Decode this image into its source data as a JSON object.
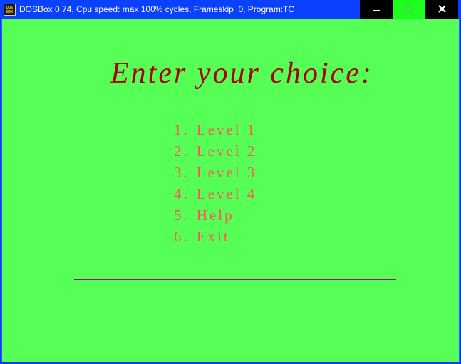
{
  "window": {
    "title": "DOSBox 0.74, Cpu speed: max 100% cycles, Frameskip  0, Program:",
    "program": "TC",
    "icon": "dosbox-icon",
    "icon_text": "DOS BOX",
    "buttons": [
      {
        "name": "minimize",
        "icon": "minimize-icon"
      },
      {
        "name": "maximize",
        "icon": "maximize-icon"
      },
      {
        "name": "close",
        "icon": "close-icon"
      }
    ]
  },
  "screen": {
    "background_color": "#55ff55",
    "heading": "Enter your choice:",
    "heading_color": "#aa0000",
    "menu_color": "#ff5555",
    "divider_color": "#aa00aa",
    "menu": [
      {
        "number": "1.",
        "label": "Level 1"
      },
      {
        "number": "2.",
        "label": "Level 2"
      },
      {
        "number": "3.",
        "label": "Level 3"
      },
      {
        "number": "4.",
        "label": "Level 4"
      },
      {
        "number": "5.",
        "label": "Help"
      },
      {
        "number": "6.",
        "label": "Exit"
      }
    ]
  }
}
